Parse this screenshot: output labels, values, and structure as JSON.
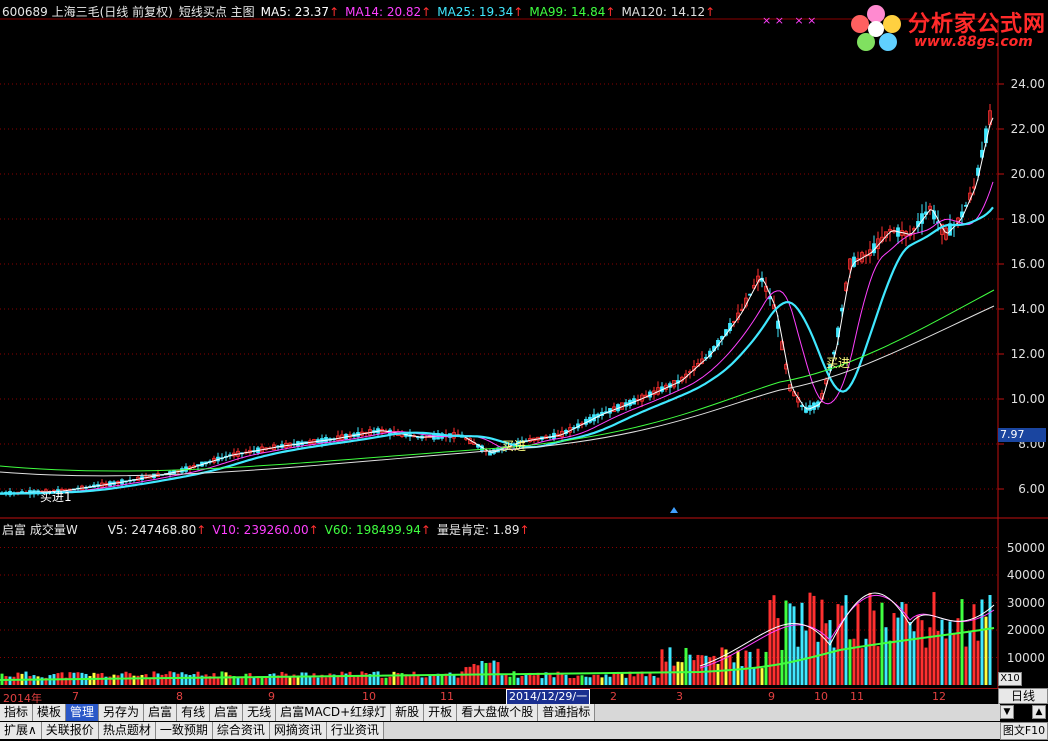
{
  "header": {
    "stock": "600689 上海三毛(日线 前复权)",
    "indicator": "短线买点 主图",
    "ma5": "MA5: 23.37",
    "ma14": "MA14: 20.82",
    "ma25": "MA25: 19.34",
    "ma99": "MA99: 14.84",
    "ma120": "MA120: 14.12",
    "arrow": "↑"
  },
  "colors": {
    "ma5": "#ffffff",
    "ma14": "#ff40ff",
    "ma25": "#40e8ff",
    "ma99": "#40ff40",
    "ma120": "#e0e0e0",
    "up": "#ff3030",
    "grid": "#8a0000"
  },
  "price_axis": [
    "24.00",
    "22.00",
    "20.00",
    "18.00",
    "16.00",
    "14.00",
    "12.00",
    "10.00",
    "8.00",
    "6.00"
  ],
  "current_price": "7.97",
  "signals": {
    "buy1": "买进",
    "buy2": "买进",
    "buy3": "买进",
    "start": "买进1"
  },
  "volume_header": {
    "title": "启富 成交量W",
    "v5": "V5: 247468.80",
    "v10": "V10: 239260.00",
    "v60": "V60: 198499.94",
    "extra": "量是肯定: 1.89",
    "arrow": "↑"
  },
  "volume_axis": [
    "50000",
    "40000",
    "30000",
    "20000",
    "10000"
  ],
  "dates": {
    "year": "2014年",
    "m7": "7",
    "m8": "8",
    "m9": "9",
    "m10": "10",
    "m11": "11",
    "cursor": "2014/12/29/一",
    "m2": "2",
    "m3": "3",
    "n9": "9",
    "n10": "10",
    "n11": "11",
    "n12": "12"
  },
  "period_button": "日线",
  "x10_button": "X10",
  "tabs1": [
    "指标",
    "模板",
    "管理",
    "另存为",
    "启富",
    "有线",
    "启富",
    "无线",
    "启富MACD+红绿灯",
    "新股",
    "开板",
    "看大盘做个股",
    "普通指标"
  ],
  "tabs2": [
    "扩展∧",
    "关联报价",
    "热点题材",
    "一致预期",
    "综合资讯",
    "网摘资讯",
    "行业资讯"
  ],
  "corner_button": "图文F10",
  "logo": {
    "title": "分析家公式网",
    "url": "www.88gs.com"
  },
  "markers": "× ×   × ×"
}
